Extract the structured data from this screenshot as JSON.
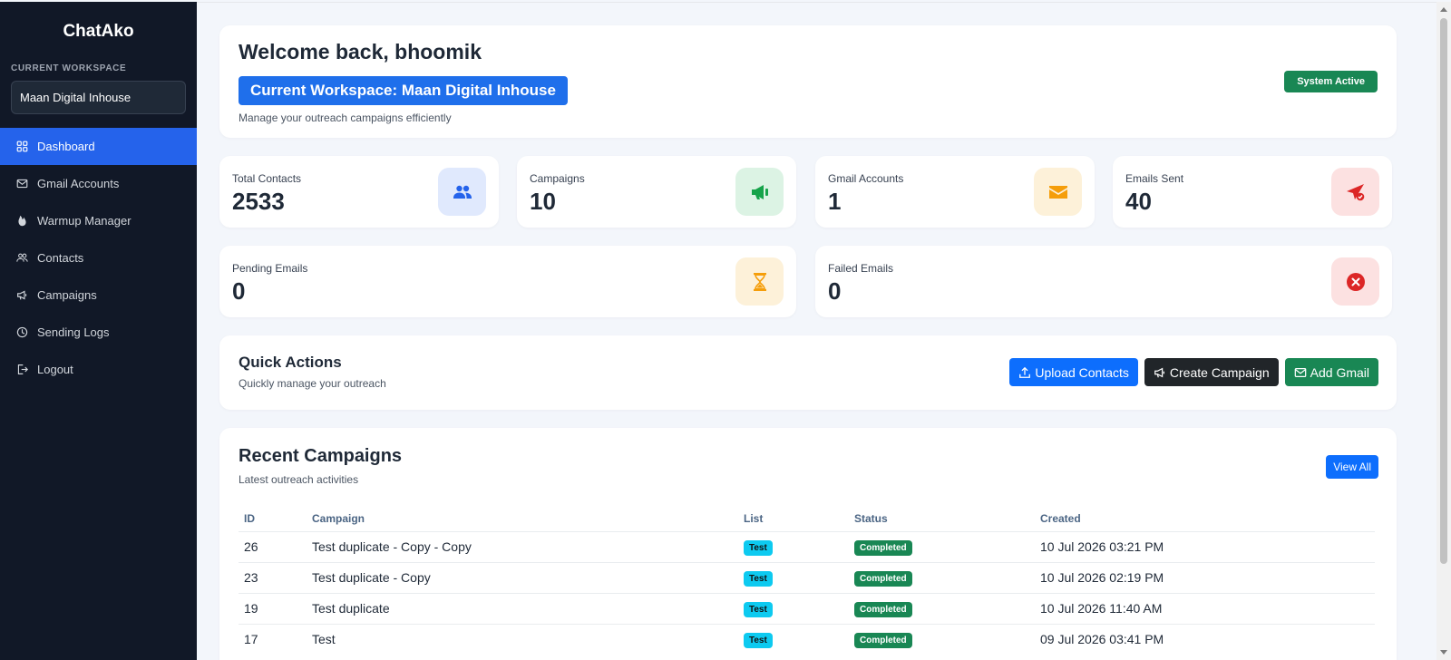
{
  "sidebar": {
    "brand": "ChatAko",
    "workspace_label": "CURRENT WORKSPACE",
    "workspace_value": "Maan Digital Inhouse",
    "items": [
      {
        "label": "Dashboard",
        "icon": "grid-icon",
        "active": true
      },
      {
        "label": "Gmail Accounts",
        "icon": "envelope-icon"
      },
      {
        "label": "Warmup Manager",
        "icon": "fire-icon"
      },
      {
        "label": "Contacts",
        "icon": "people-icon"
      },
      {
        "label": "Campaigns",
        "icon": "megaphone-icon"
      },
      {
        "label": "Sending Logs",
        "icon": "clock-icon"
      },
      {
        "label": "Logout",
        "icon": "logout-icon"
      }
    ]
  },
  "welcome": {
    "title": "Welcome back, bhoomik",
    "workspace_banner": "Current Workspace: Maan Digital Inhouse",
    "subtitle": "Manage your outreach campaigns efficiently",
    "status_badge": "System Active"
  },
  "stats": [
    {
      "label": "Total Contacts",
      "value": "2533",
      "icon": "people-icon",
      "color": "#2563eb"
    },
    {
      "label": "Campaigns",
      "value": "10",
      "icon": "megaphone-icon",
      "color": "#16a34a"
    },
    {
      "label": "Gmail Accounts",
      "value": "1",
      "icon": "envelope-icon",
      "color": "#f59e0b"
    },
    {
      "label": "Emails Sent",
      "value": "40",
      "icon": "send-check-icon",
      "color": "#dc2626"
    },
    {
      "label": "Pending Emails",
      "value": "0",
      "icon": "hourglass-icon",
      "color": "#f59e0b"
    },
    {
      "label": "Failed Emails",
      "value": "0",
      "icon": "x-circle-icon",
      "color": "#dc2626"
    }
  ],
  "quick_actions": {
    "title": "Quick Actions",
    "subtitle": "Quickly manage your outreach",
    "upload_label": "Upload Contacts",
    "create_label": "Create Campaign",
    "add_gmail_label": "Add Gmail"
  },
  "recent": {
    "title": "Recent Campaigns",
    "subtitle": "Latest outreach activities",
    "view_all": "View All",
    "columns": [
      "ID",
      "Campaign",
      "List",
      "Status",
      "Created"
    ],
    "rows": [
      {
        "id": "26",
        "campaign": "Test duplicate - Copy - Copy",
        "list": "Test",
        "status": "Completed",
        "created": "10 Jul 2026 03:21 PM"
      },
      {
        "id": "23",
        "campaign": "Test duplicate - Copy",
        "list": "Test",
        "status": "Completed",
        "created": "10 Jul 2026 02:19 PM"
      },
      {
        "id": "19",
        "campaign": "Test duplicate",
        "list": "Test",
        "status": "Completed",
        "created": "10 Jul 2026 11:40 AM"
      },
      {
        "id": "17",
        "campaign": "Test",
        "list": "Test",
        "status": "Completed",
        "created": "09 Jul 2026 03:41 PM"
      }
    ]
  },
  "colors": {
    "sidebar_bg": "#111827",
    "accent": "#2563eb",
    "success": "#198754",
    "info": "#0dcaf0"
  }
}
